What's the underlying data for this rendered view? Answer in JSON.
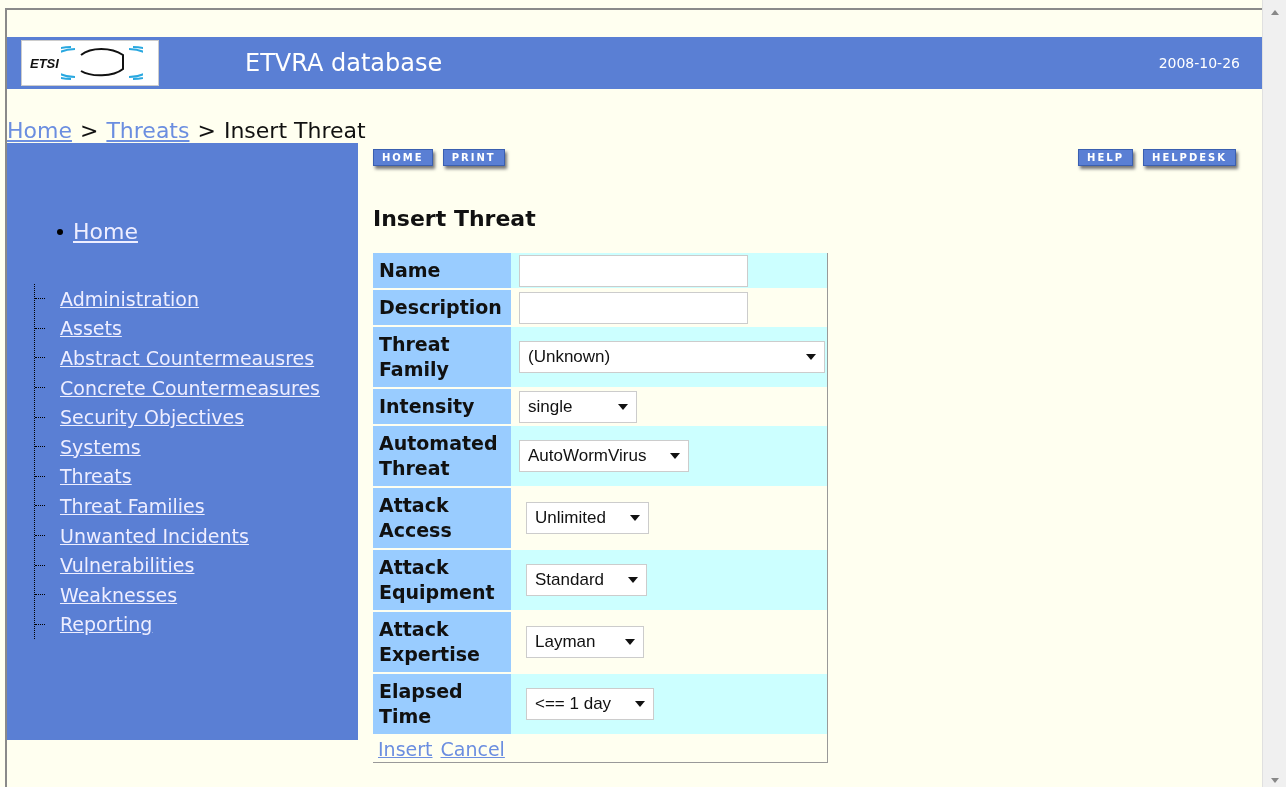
{
  "header": {
    "logo_text": "ETSI",
    "title": "ETVRA database",
    "date": "2008-10-26"
  },
  "breadcrumb": [
    {
      "label": "Home",
      "link": true
    },
    {
      "label": ">",
      "link": false
    },
    {
      "label": "Threats",
      "link": true
    },
    {
      "label": ">",
      "link": false
    },
    {
      "label": "Insert Threat",
      "link": false
    }
  ],
  "toolbar_left": [
    "HOME",
    "PRINT"
  ],
  "toolbar_right": [
    "HELP",
    "HELPDESK"
  ],
  "sidebar": {
    "home": "Home",
    "items": [
      "Administration",
      "Assets",
      "Abstract Countermeausres",
      "Concrete Countermeasures",
      "Security Objectives",
      "Systems",
      "Threats",
      "Threat Families",
      "Unwanted Incidents",
      "Vulnerabilities",
      "Weaknesses",
      "Reporting"
    ]
  },
  "form": {
    "title": "Insert Threat",
    "rows": [
      {
        "kind": "text",
        "label": "Name",
        "value": ""
      },
      {
        "kind": "text",
        "label": "Description",
        "value": ""
      },
      {
        "kind": "select",
        "label": "Threat Family",
        "value": "(Unknown)"
      },
      {
        "kind": "select",
        "label": "Intensity",
        "value": "single"
      },
      {
        "kind": "select",
        "label": "Automated Threat",
        "value": "AutoWormVirus"
      },
      {
        "kind": "select",
        "label": "Attack Access",
        "value": "Unlimited"
      },
      {
        "kind": "select",
        "label": "Attack Equipment",
        "value": "Standard"
      },
      {
        "kind": "select",
        "label": "Attack Expertise",
        "value": "Layman"
      },
      {
        "kind": "select",
        "label": "Elapsed Time",
        "value": "<== 1 day"
      }
    ],
    "actions": [
      "Insert",
      "Cancel"
    ]
  }
}
